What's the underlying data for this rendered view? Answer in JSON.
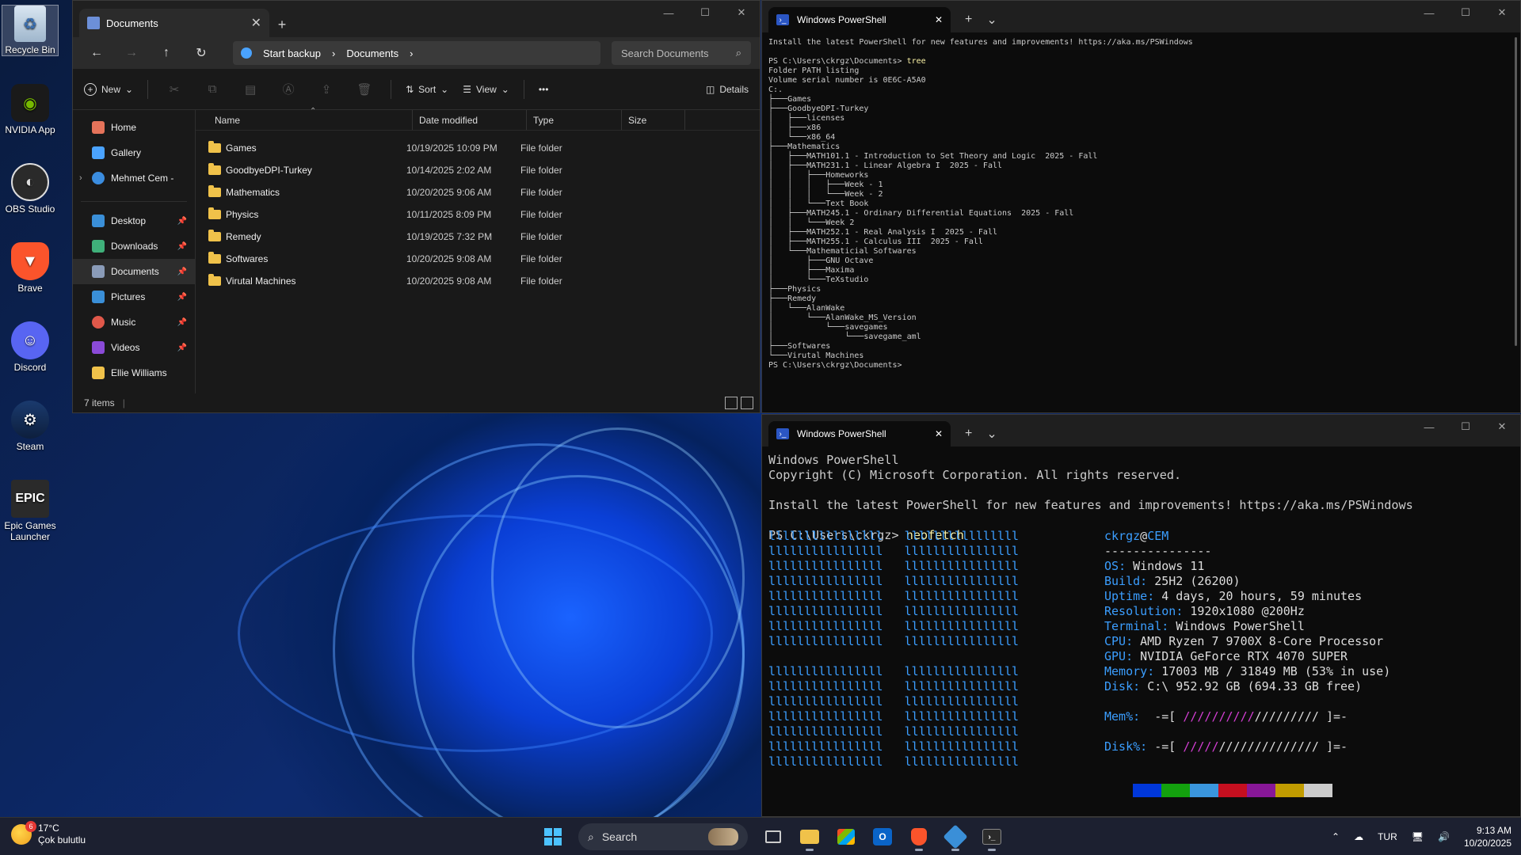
{
  "desktop": {
    "icons": [
      {
        "label": "Recycle Bin",
        "glyph": "recycle-bin-icon"
      },
      {
        "label": "NVIDIA App",
        "glyph": "nvidia-icon"
      },
      {
        "label": "OBS Studio",
        "glyph": "obs-icon"
      },
      {
        "label": "Brave",
        "glyph": "brave-icon"
      },
      {
        "label": "Discord",
        "glyph": "discord-icon"
      },
      {
        "label": "Steam",
        "glyph": "steam-icon"
      },
      {
        "label": "Epic Games Launcher",
        "glyph": "epic-icon"
      }
    ],
    "epic_logo_text": "EPIC"
  },
  "explorer": {
    "tab_title": "Documents",
    "breadcrumb": [
      "Start backup",
      "Documents"
    ],
    "search_placeholder": "Search Documents",
    "toolbar": {
      "new": "New",
      "sort": "Sort",
      "view": "View",
      "more": "•••",
      "details": "Details"
    },
    "sidebar": [
      {
        "label": "Home",
        "color": "#e5735a"
      },
      {
        "label": "Gallery",
        "color": "#4aa3ff"
      },
      {
        "label": "Mehmet Cem -",
        "color": "#3b8de0"
      },
      {
        "label": "Desktop",
        "color": "#3a8fd8"
      },
      {
        "label": "Downloads",
        "color": "#3fb07a"
      },
      {
        "label": "Documents",
        "color": "#8a9bb8"
      },
      {
        "label": "Pictures",
        "color": "#3a8fd8"
      },
      {
        "label": "Music",
        "color": "#e0584a"
      },
      {
        "label": "Videos",
        "color": "#8a4ad8"
      },
      {
        "label": "Ellie Williams",
        "color": "#f0c24a"
      }
    ],
    "columns": [
      "Name",
      "Date modified",
      "Type",
      "Size"
    ],
    "rows": [
      {
        "name": "Games",
        "date": "10/19/2025 10:09 PM",
        "type": "File folder"
      },
      {
        "name": "GoodbyeDPI-Turkey",
        "date": "10/14/2025 2:02 AM",
        "type": "File folder"
      },
      {
        "name": "Mathematics",
        "date": "10/20/2025 9:06 AM",
        "type": "File folder"
      },
      {
        "name": "Physics",
        "date": "10/11/2025 8:09 PM",
        "type": "File folder"
      },
      {
        "name": "Remedy",
        "date": "10/19/2025 7:32 PM",
        "type": "File folder"
      },
      {
        "name": "Softwares",
        "date": "10/20/2025 9:08 AM",
        "type": "File folder"
      },
      {
        "name": "Virutal Machines",
        "date": "10/20/2025 9:08 AM",
        "type": "File folder"
      }
    ],
    "status": "7 items"
  },
  "ps1": {
    "tab_title": "Windows PowerShell",
    "lines": [
      "Install the latest PowerShell for new features and improvements! https://aka.ms/PSWindows",
      "",
      "PS C:\\Users\\ckrgz\\Documents> ",
      "Folder PATH listing",
      "Volume serial number is 0E6C-A5A0",
      "C:.",
      "├───Games",
      "├───GoodbyeDPI-Turkey",
      "│   ├───licenses",
      "│   ├───x86",
      "│   └───x86_64",
      "├───Mathematics",
      "│   ├───MATH101.1 - Introduction to Set Theory and Logic  2025 - Fall",
      "│   ├───MATH231.1 - Linear Algebra I  2025 - Fall",
      "│   │   ├───Homeworks",
      "│   │   │   ├───Week - 1",
      "│   │   │   └───Week - 2",
      "│   │   └───Text Book",
      "│   ├───MATH245.1 - Ordinary Differential Equations  2025 - Fall",
      "│   │   └───Week 2",
      "│   ├───MATH252.1 - Real Analysis I  2025 - Fall",
      "│   ├───MATH255.1 - Calculus III  2025 - Fall",
      "│   └───Mathematicial Softwares",
      "│       ├───GNU Octave",
      "│       ├───Maxima",
      "│       └───TeXstudio",
      "├───Physics",
      "├───Remedy",
      "│   └───AlanWake",
      "│       └───AlanWake_MS_Version",
      "│           └───savegames",
      "│               └───savegame_aml",
      "├───Softwares",
      "└───Virutal Machines",
      "PS C:\\Users\\ckrgz\\Documents>"
    ],
    "command": "tree"
  },
  "ps2": {
    "tab_title": "Windows PowerShell",
    "header": [
      "Windows PowerShell",
      "Copyright (C) Microsoft Corporation. All rights reserved.",
      "",
      "Install the latest PowerShell for new features and improvements! https://aka.ms/PSWindows",
      ""
    ],
    "prompt": "PS C:\\Users\\ckrgz> ",
    "command": "neofetch",
    "logo_line": "llllllllllllllll   llllllllllllllll",
    "user": "ckrgz",
    "host": "CEM",
    "underline": "---------------",
    "info": [
      {
        "k": "OS",
        "v": "Windows 11"
      },
      {
        "k": "Build",
        "v": "25H2 (26200)"
      },
      {
        "k": "Uptime",
        "v": "4 days, 20 hours, 59 minutes"
      },
      {
        "k": "Resolution",
        "v": "1920x1080 @200Hz"
      },
      {
        "k": "Terminal",
        "v": "Windows PowerShell"
      },
      {
        "k": "CPU",
        "v": "AMD Ryzen 7 9700X 8-Core Processor"
      },
      {
        "k": "GPU",
        "v": "NVIDIA GeForce RTX 4070 SUPER"
      },
      {
        "k": "Memory",
        "v": "17003 MB / 31849 MB (53% in use)"
      },
      {
        "k": "Disk",
        "v": "C:\\ 952.92 GB (694.33 GB free)"
      }
    ],
    "mem_label": "Mem%:",
    "mem_bar_used": "//////////",
    "mem_bar_free": "/////////",
    "disk_label": "Disk%:",
    "disk_bar_used": "/////",
    "disk_bar_free": "//////////////",
    "bar_open": "-=[ ",
    "bar_close": " ]=-",
    "swatch_colors": [
      "#0037da",
      "#13a10e",
      "#3a96dd",
      "#c50f1f",
      "#881798",
      "#c19c00",
      "#cccccc"
    ]
  },
  "taskbar": {
    "weather_temp": "17°C",
    "weather_desc": "Çok bulutlu",
    "weather_badge": "6",
    "search_label": "Search",
    "lang": "TUR",
    "time": "9:13 AM",
    "date": "10/20/2025"
  }
}
